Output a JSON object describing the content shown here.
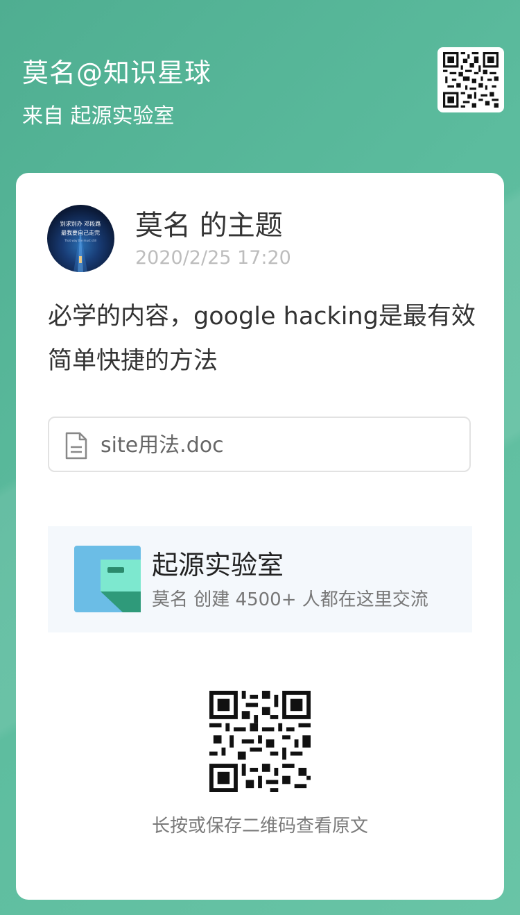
{
  "header": {
    "title": "莫名@知识星球",
    "subtitle": "来自 起源实验室",
    "qr_icon": "qr-code-icon"
  },
  "post": {
    "author_line": "莫名 的主题",
    "timestamp": "2020/2/25 17:20",
    "content": "必学的内容，google  hacking是最有效简单快捷的方法",
    "avatar_text": {
      "line1": "别求别办 邓段路",
      "line2": "最我要自己走完",
      "line3": "That way the must still"
    }
  },
  "attachment": {
    "icon": "document-icon",
    "filename": "site用法.doc"
  },
  "group": {
    "name": "起源实验室",
    "description": "莫名 创建 4500+ 人都在这里交流",
    "logo_icon": "planet-logo-icon"
  },
  "footer": {
    "hint": "长按或保存二维码查看原文",
    "qr_icon": "qr-code-icon"
  },
  "colors": {
    "background": "#58b89b",
    "card": "#ffffff",
    "group_bg": "#f4f8fc",
    "logo_blue": "#6bbde6",
    "logo_mint": "#7de8cf",
    "logo_dark_green": "#2f9a7a"
  }
}
